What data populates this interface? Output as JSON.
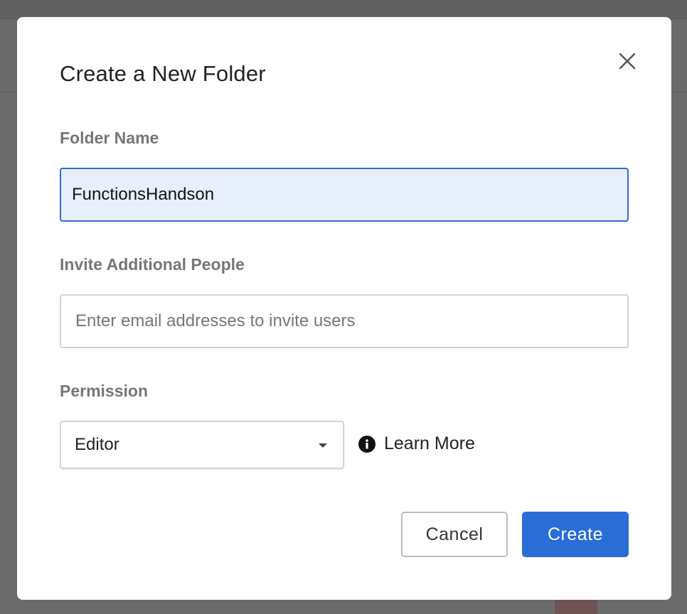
{
  "dialog": {
    "title": "Create a New Folder",
    "close_icon": "close-icon"
  },
  "folder_name": {
    "label": "Folder Name",
    "value": "FunctionsHandson"
  },
  "invite": {
    "label": "Invite Additional People",
    "placeholder": "Enter email addresses to invite users",
    "value": ""
  },
  "permission": {
    "label": "Permission",
    "selected": "Editor",
    "learn_more_label": "Learn More",
    "info_icon": "info-icon"
  },
  "actions": {
    "cancel_label": "Cancel",
    "create_label": "Create"
  },
  "colors": {
    "primary": "#2a6dd6",
    "input_focus_bg": "#e8f0fe",
    "label_gray": "#767676"
  }
}
